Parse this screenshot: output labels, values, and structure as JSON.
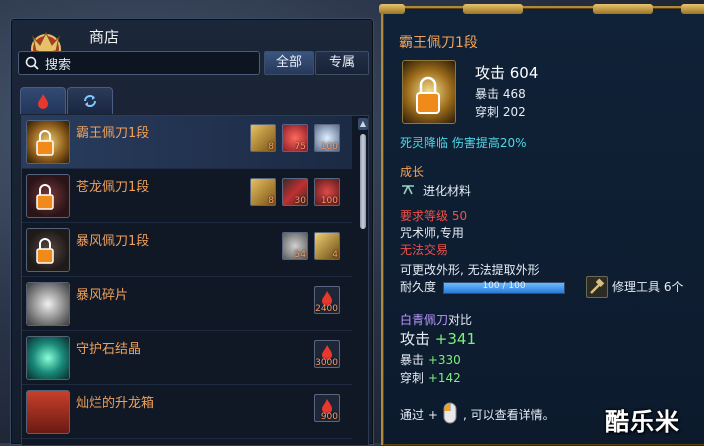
{
  "shop": {
    "title": "商店",
    "search_text": "搜索",
    "filters": {
      "all": "全部",
      "exclusive": "专属"
    },
    "tabs": [
      {
        "icon": "flame-tab-icon"
      },
      {
        "icon": "refresh-tab-icon"
      }
    ],
    "items": [
      {
        "name": "霸王佩刀1段",
        "selected": true,
        "costs": [
          {
            "icon": "gold-bar-icon",
            "count": "8"
          },
          {
            "icon": "red-orb-icon",
            "count": "75"
          },
          {
            "icon": "crystal-icon",
            "count": "100"
          }
        ]
      },
      {
        "name": "苍龙佩刀1段",
        "selected": false,
        "costs": [
          {
            "icon": "gold-bar-icon",
            "count": "8"
          },
          {
            "icon": "red-blade-icon",
            "count": "30"
          },
          {
            "icon": "crimson-stone-icon",
            "count": "100"
          }
        ]
      },
      {
        "name": "暴风佩刀1段",
        "selected": false,
        "costs": [
          {
            "icon": "grey-ore-icon",
            "count": "54"
          },
          {
            "icon": "gold-token-icon",
            "count": "4"
          }
        ]
      },
      {
        "name": "暴风碎片",
        "selected": false,
        "costs": [
          {
            "icon": "red-flame-icon",
            "count": "2400"
          }
        ]
      },
      {
        "name": "守护石结晶",
        "selected": false,
        "costs": [
          {
            "icon": "red-flame-icon",
            "count": "3000"
          }
        ]
      },
      {
        "name": "灿烂的升龙箱",
        "selected": false,
        "costs": [
          {
            "icon": "red-flame-icon",
            "count": "900"
          }
        ]
      }
    ]
  },
  "tooltip": {
    "title": "霸王佩刀1段",
    "attack": "攻击 604",
    "crit": "暴击 468",
    "pierce": "穿刺 202",
    "effect": "死灵降临 伤害提高20%",
    "growth_label": "成长",
    "growth_material": "进化材料",
    "level_req": "要求等级 50",
    "class_only": "咒术师,专用",
    "no_trade": "无法交易",
    "appearance": "可更改外形, 无法提取外形",
    "durability_label": "耐久度",
    "durability_text": "100 / 100",
    "durability_fraction": 1.0,
    "repair": "修理工具 6个",
    "compare_item": "白青佩刀",
    "compare_suffix": "对比",
    "cmp_attack_label": "攻击",
    "cmp_attack_val": "+341",
    "cmp_crit_label": "暴击",
    "cmp_crit_val": "+330",
    "cmp_pierce_label": "穿刺",
    "cmp_pierce_val": "+142",
    "hint_prefix": "通过 +",
    "hint_suffix": ", 可以查看详情。"
  },
  "watermark": "酷乐米",
  "colors": {
    "item_name": "#f0a05a",
    "border_gold": "#b08a3c",
    "cyan": "#4fd8e8",
    "green": "#7ef07a",
    "red": "#f0504a"
  }
}
